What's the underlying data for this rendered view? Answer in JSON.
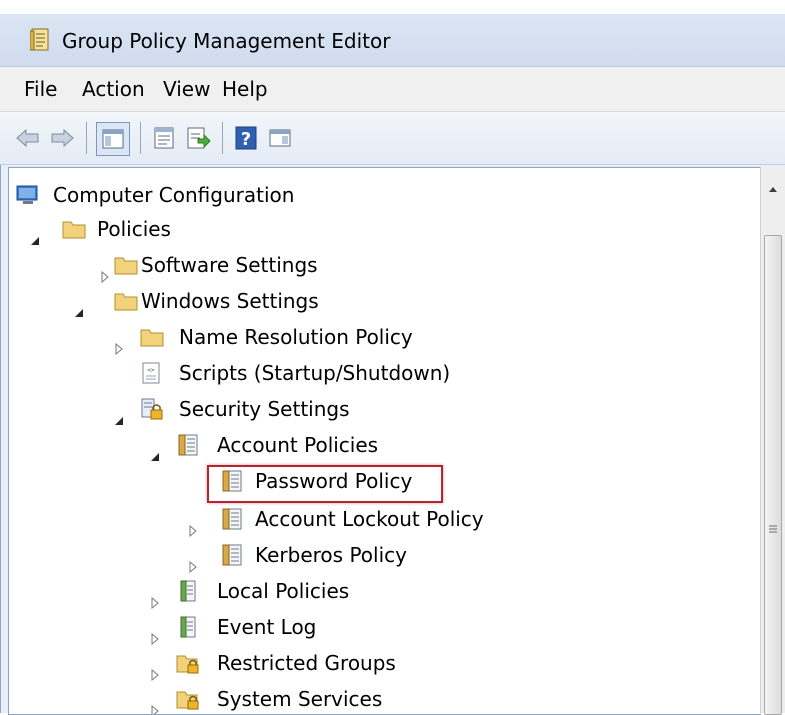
{
  "window": {
    "title": "Group Policy Management Editor",
    "title_icon": "gpmc-editor-icon"
  },
  "menu": {
    "items": [
      "File",
      "Action",
      "View",
      "Help"
    ]
  },
  "toolbar": {
    "buttons": [
      "back-arrow-icon",
      "forward-arrow-icon",
      "show-hide-console-tree-icon",
      "properties-icon",
      "export-list-icon",
      "help-icon",
      "show-hide-action-pane-icon"
    ]
  },
  "tree": {
    "nodes": [
      {
        "label": "Computer Configuration",
        "icon": "computer-config-icon",
        "expander": "none"
      },
      {
        "label": "Policies",
        "icon": "folder-icon",
        "expander": "expanded"
      },
      {
        "label": "Software Settings",
        "icon": "folder-icon",
        "expander": "collapsed"
      },
      {
        "label": "Windows Settings",
        "icon": "folder-icon",
        "expander": "expanded"
      },
      {
        "label": "Name Resolution Policy",
        "icon": "folder-icon",
        "expander": "collapsed"
      },
      {
        "label": "Scripts (Startup/Shutdown)",
        "icon": "script-icon",
        "expander": "none"
      },
      {
        "label": "Security Settings",
        "icon": "security-settings-icon",
        "expander": "expanded"
      },
      {
        "label": "Account Policies",
        "icon": "policy-icon",
        "expander": "expanded"
      },
      {
        "label": "Password Policy",
        "icon": "policy-icon",
        "expander": "none",
        "highlighted": true
      },
      {
        "label": "Account Lockout Policy",
        "icon": "policy-icon",
        "expander": "collapsed"
      },
      {
        "label": "Kerberos Policy",
        "icon": "policy-icon",
        "expander": "collapsed"
      },
      {
        "label": "Local Policies",
        "icon": "policy-book-icon",
        "expander": "collapsed"
      },
      {
        "label": "Event Log",
        "icon": "policy-book-icon",
        "expander": "collapsed"
      },
      {
        "label": "Restricted Groups",
        "icon": "locked-folder-icon",
        "expander": "collapsed"
      },
      {
        "label": "System Services",
        "icon": "locked-folder-icon",
        "expander": "collapsed"
      }
    ]
  },
  "colors": {
    "highlight_border": "#c0202a",
    "folder": "#f2d27a",
    "selection": "#3399ff"
  }
}
